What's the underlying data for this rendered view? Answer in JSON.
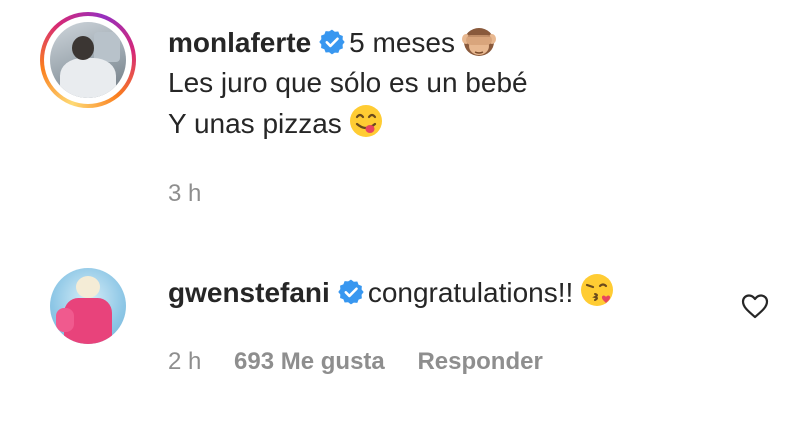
{
  "comments": [
    {
      "username": "monlaferte",
      "verified": true,
      "lines": [
        "5 meses",
        "Les juro que sólo es un bebé",
        "Y unas pizzas"
      ],
      "emojis": [
        "see-no-evil-monkey-emoji",
        "face-savoring-food-emoji"
      ],
      "time": "3 h"
    },
    {
      "username": "gwenstefani",
      "verified": true,
      "text": "congratulations!!",
      "emoji": "face-blowing-kiss-emoji",
      "time": "2 h",
      "likes": "693 Me gusta",
      "reply": "Responder"
    }
  ],
  "colors": {
    "verified": "#3897f0",
    "meta": "#8e8e8e",
    "text": "#262626"
  }
}
